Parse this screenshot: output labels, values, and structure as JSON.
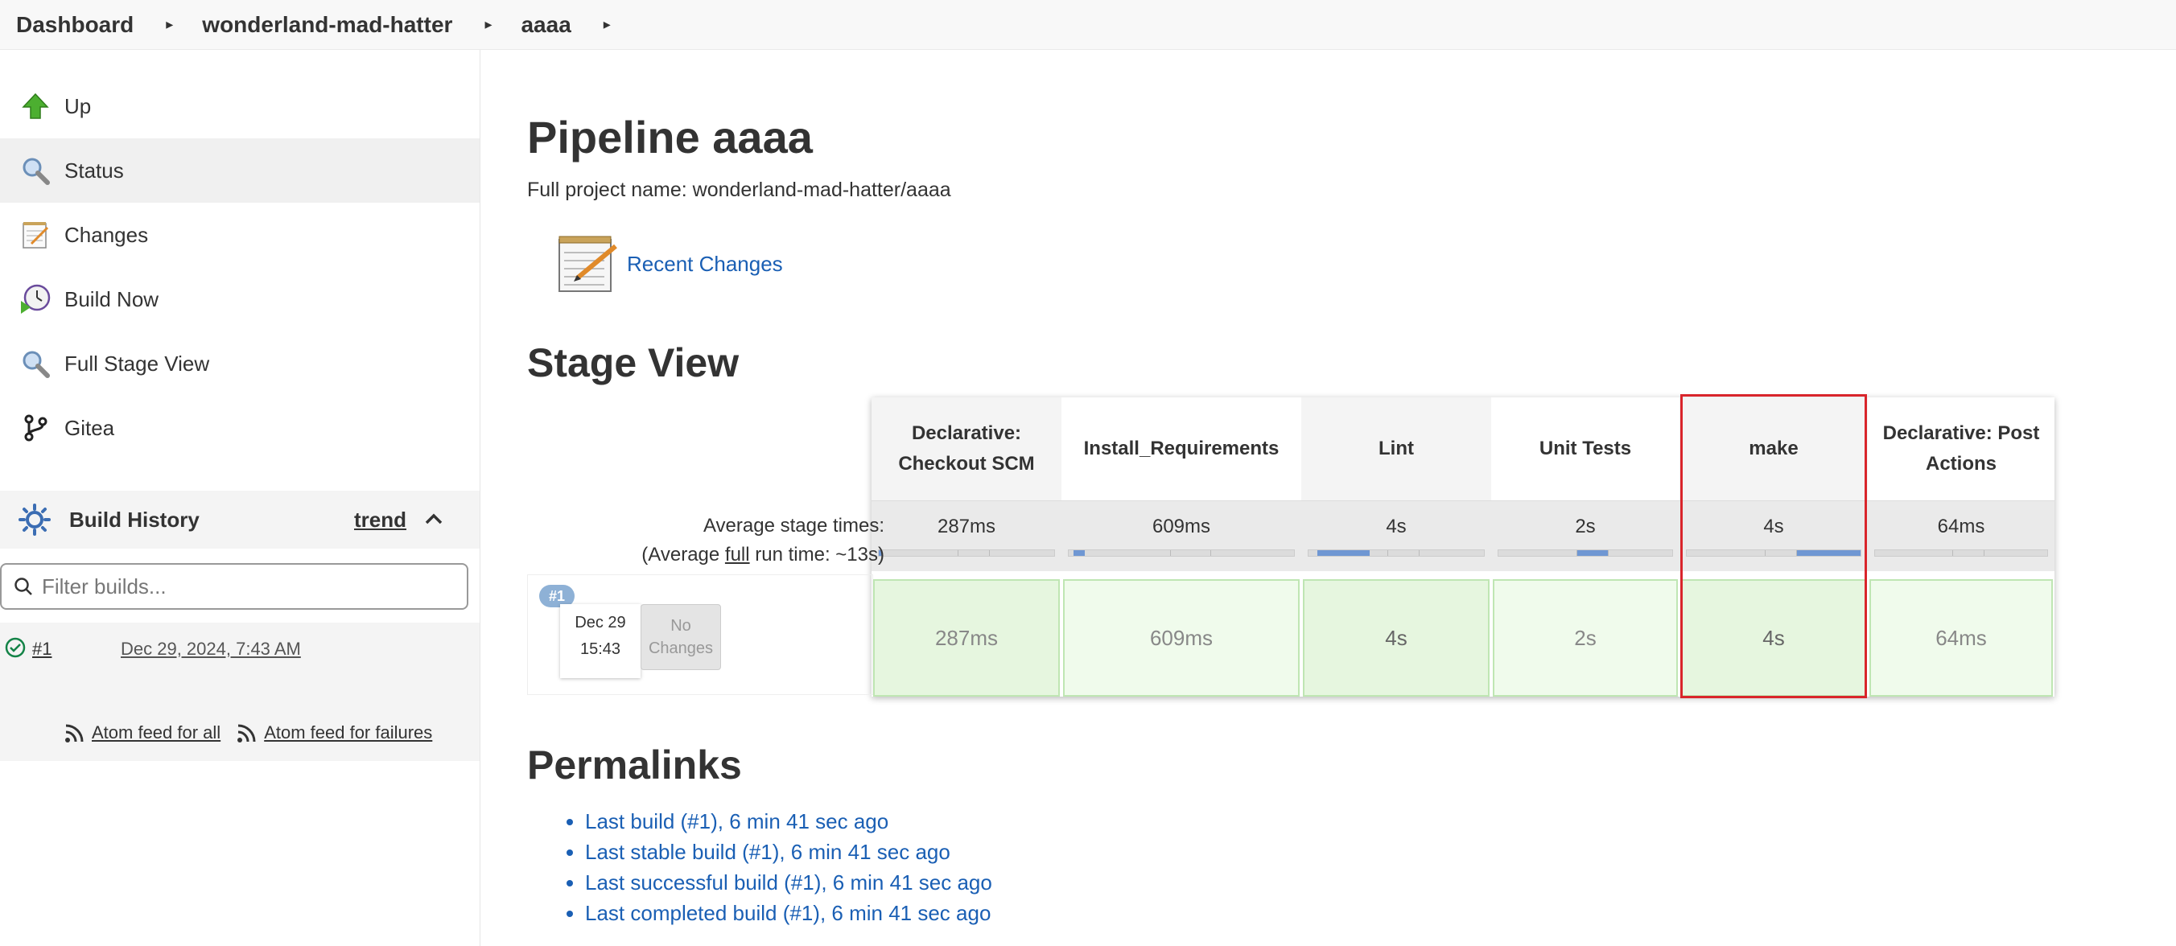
{
  "breadcrumb": {
    "items": [
      "Dashboard",
      "wonderland-mad-hatter",
      "aaaa"
    ]
  },
  "sidebar": {
    "tasks": [
      {
        "label": "Up",
        "icon": "up-arrow-icon"
      },
      {
        "label": "Status",
        "icon": "magnifier-icon"
      },
      {
        "label": "Changes",
        "icon": "notepad-icon"
      },
      {
        "label": "Build Now",
        "icon": "clock-play-icon"
      },
      {
        "label": "Full Stage View",
        "icon": "magnifier-icon"
      },
      {
        "label": "Gitea",
        "icon": "git-branch-icon"
      }
    ],
    "build_history": {
      "title": "Build History",
      "trend": "trend",
      "filter_placeholder": "Filter builds...",
      "build": {
        "number": "#1",
        "date": "Dec 29, 2024, 7:43 AM"
      },
      "feed_all": "Atom feed for all",
      "feed_failures": "Atom feed for failures"
    }
  },
  "main": {
    "title": "Pipeline aaaa",
    "full_name": "Full project name: wonderland-mad-hatter/aaaa",
    "recent_changes": "Recent Changes",
    "stage_view_title": "Stage View",
    "avg_label": "Average stage times:",
    "avg_full_prefix": "(Average ",
    "avg_full_word": "full",
    "avg_full_suffix": " run time: ~13s)",
    "build_badge": "#1",
    "build_date": "Dec 29",
    "build_time": "15:43",
    "no_changes": "No Changes",
    "stages": [
      {
        "name": "Declarative: Checkout SCM",
        "avg": "287ms",
        "run": "287ms",
        "bar_start": 0.0,
        "bar_len": 0.02
      },
      {
        "name": "Install_Requirements",
        "avg": "609ms",
        "run": "609ms",
        "bar_start": 0.02,
        "bar_len": 0.05
      },
      {
        "name": "Lint",
        "avg": "4s",
        "run": "4s",
        "bar_start": 0.05,
        "bar_len": 0.3
      },
      {
        "name": "Unit Tests",
        "avg": "2s",
        "run": "2s",
        "bar_start": 0.45,
        "bar_len": 0.18
      },
      {
        "name": "make",
        "avg": "4s",
        "run": "4s",
        "bar_start": 0.63,
        "bar_len": 0.37
      },
      {
        "name": "Declarative: Post Actions",
        "avg": "64ms",
        "run": "64ms",
        "bar_start": 0.0,
        "bar_len": 0.0
      }
    ],
    "permalinks_title": "Permalinks",
    "permalinks": [
      "Last build (#1), 6 min 41 sec ago",
      "Last stable build (#1), 6 min 41 sec ago",
      "Last successful build (#1), 6 min 41 sec ago",
      "Last completed build (#1), 6 min 41 sec ago"
    ]
  },
  "colors": {
    "link": "#1a5fb4",
    "success_green": "#e6f6df",
    "highlight_red": "#d9252b",
    "bar_blue": "#6f97d3"
  }
}
